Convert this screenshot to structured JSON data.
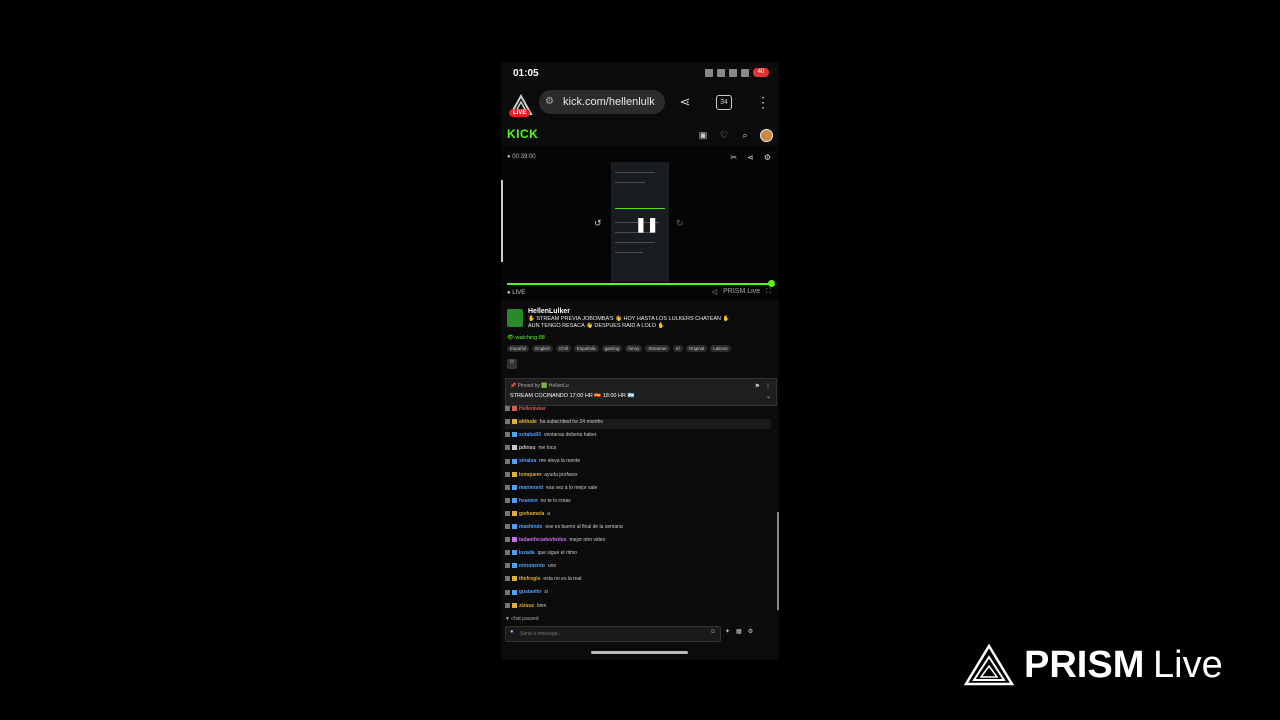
{
  "status_bar": {
    "time": "01:05",
    "battery": "40"
  },
  "browser": {
    "url": "kick.com/hellenlulk",
    "tab_count": "34",
    "live_badge": "LIVE"
  },
  "kick": {
    "logo": "KICK"
  },
  "player": {
    "top_left": "● 00:39:00",
    "live_label": "● LIVE",
    "progress": 1.0,
    "bottom_right": "PRISM Live"
  },
  "channel": {
    "name": "HellenLulker",
    "title_line1": "✋ STREAM PREVIA JOBOMBA’S 👋 HOY HASTA LOS LULKERS CHATEAN ✋",
    "title_line2": "AUN TENGO RESACA 👋 DESPUES RAID A LOLO ✋",
    "viewers": "👁 watching 88",
    "tags": [
      "Español",
      "English",
      "Chill",
      "Española",
      "gaming",
      "funny",
      "Streamer",
      "Irl",
      "Original",
      "Latinos"
    ]
  },
  "pinned": {
    "meta": "📌 Pinned by 🟩 HellenLu",
    "text": "STREAM COCINANDO 17:00 HR 🇪🇸 18:00 HR 🇦🇷"
  },
  "chat": [
    {
      "user": "Hellenluker",
      "msg": "",
      "color": "#e05a5a"
    },
    {
      "user": "altitude",
      "msg": "ha subscribed for 24 months",
      "color": "#e0b030",
      "highlight": true
    },
    {
      "user": "xotaludi3",
      "msg": "ventanas deberia haber",
      "color": "#4aa3ff"
    },
    {
      "user": "pdinsu",
      "msg": "me toca",
      "color": "#c8c8c8"
    },
    {
      "user": "sinaloa",
      "msg": "me eleva la mente",
      "color": "#4aa3ff"
    },
    {
      "user": "lomquem",
      "msg": "ayuda porfavor",
      "color": "#e0b030"
    },
    {
      "user": "marimonti",
      "msg": "esa vez a lo mejor sale",
      "color": "#4aa3ff"
    },
    {
      "user": "hsaxmx",
      "msg": "no te lo creas",
      "color": "#4aa3ff"
    },
    {
      "user": "gorkamola",
      "msg": "a",
      "color": "#e0b030"
    },
    {
      "user": "mashinds",
      "msg": "ese es bueno al final de la semana",
      "color": "#4aa3ff"
    },
    {
      "user": "tadamfxcaduvbrdos",
      "msg": "mejor otro video",
      "color": "#c86ef0"
    },
    {
      "user": "lozada",
      "msg": "que sigue el ritmo",
      "color": "#4aa3ff"
    },
    {
      "user": "mirumento",
      "msg": "uno",
      "color": "#4aa3ff"
    },
    {
      "user": "thefrogis",
      "msg": "esta no es la real",
      "color": "#e0b030"
    },
    {
      "user": "gustavito",
      "msg": "si",
      "color": "#4aa3ff"
    },
    {
      "user": "zizuuz",
      "msg": "bien",
      "color": "#e0b030"
    }
  ],
  "chat_footer": {
    "paused": "▼ chat paused",
    "input_placeholder": "Send a message..."
  },
  "watermark": {
    "brand": "PRISM",
    "suffix": "Live"
  }
}
